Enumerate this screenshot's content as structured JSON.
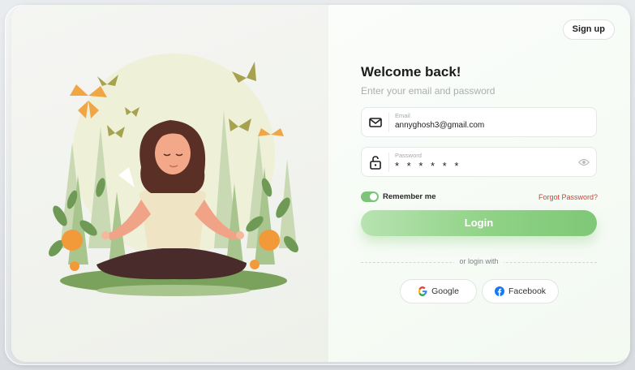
{
  "header": {
    "signup_label": "Sign up"
  },
  "form": {
    "title": "Welcome back!",
    "subtitle": "Enter your email and password",
    "email": {
      "label": "Email",
      "value": "annyghosh3@gmail.com",
      "icon": "mail-icon"
    },
    "password": {
      "label": "Password",
      "value": "* * * * * *",
      "icon": "unlock-icon",
      "toggle_icon": "eye-icon"
    },
    "remember": {
      "label": "Remember me",
      "checked": true
    },
    "forgot_label": "Forgot Password?",
    "login_label": "Login",
    "divider_text": "or login with",
    "social": [
      {
        "label": "Google",
        "icon": "google-icon"
      },
      {
        "label": "Facebook",
        "icon": "facebook-icon"
      }
    ]
  },
  "colors": {
    "accent": "#8fd286",
    "forgot": "#d6402f",
    "facebook": "#1877f2"
  }
}
